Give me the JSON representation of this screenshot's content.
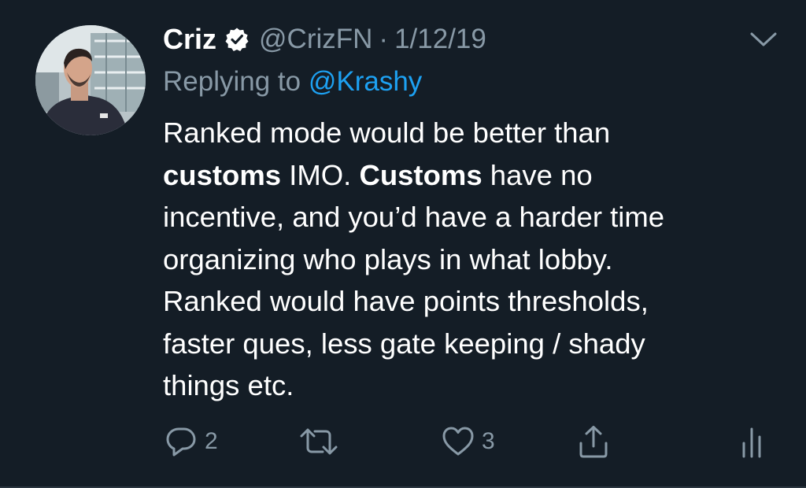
{
  "tweet": {
    "author_name": "Criz",
    "handle": "@CrizFN",
    "separator": "·",
    "date": "1/12/19",
    "verified": true,
    "replying_prefix": "Replying to",
    "replying_to": "@Krashy",
    "body_lines": [
      [
        {
          "text": "Ranked mode would be better than"
        }
      ],
      [
        {
          "text": "customs",
          "bold": true
        },
        {
          "text": " IMO. "
        },
        {
          "text": "Customs",
          "bold": true
        },
        {
          "text": " have no"
        }
      ],
      [
        {
          "text": "incentive, and you’d have a harder time"
        }
      ],
      [
        {
          "text": "organizing who plays in what lobby."
        }
      ],
      [
        {
          "text": "Ranked would have points thresholds,"
        }
      ],
      [
        {
          "text": "faster ques, less gate keeping / shady"
        }
      ],
      [
        {
          "text": "things etc."
        }
      ]
    ]
  },
  "actions": {
    "reply_count": "2",
    "retweet_count": "",
    "like_count": "3"
  },
  "icons": {
    "avatar": "avatar-photo",
    "verified": "verified-badge-icon",
    "chevron": "chevron-down-icon",
    "reply": "reply-icon",
    "retweet": "retweet-icon",
    "like": "heart-icon",
    "share": "share-icon",
    "analytics": "analytics-icon"
  },
  "colors": {
    "background": "#141d26",
    "text": "#ffffff",
    "secondary": "#8899a6",
    "link": "#1da1f2",
    "verified_badge": "#ffffff"
  }
}
